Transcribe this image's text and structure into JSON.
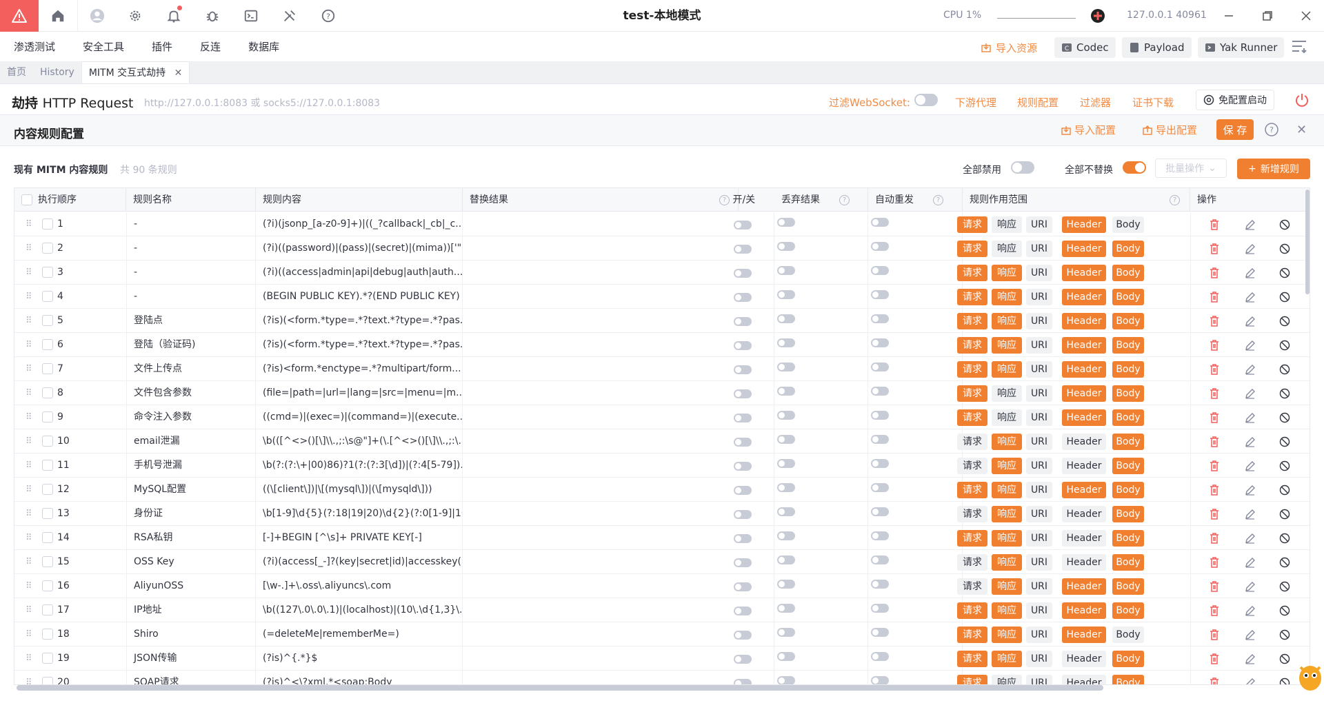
{
  "window": {
    "title": "test-本地模式",
    "cpu": "CPU 1%",
    "address": "127.0.0.1 40961"
  },
  "menu": [
    "渗透测试",
    "安全工具",
    "插件",
    "反连",
    "数据库"
  ],
  "toolbar": {
    "import_resource": "导入资源",
    "codec": "Codec",
    "payload": "Payload",
    "yak_runner": "Yak Runner"
  },
  "tabs": [
    {
      "label": "首页"
    },
    {
      "label": "History"
    },
    {
      "label": "MITM 交互式劫持",
      "closable": true
    }
  ],
  "hijack": {
    "title_cn": "劫持",
    "title_en": "HTTP Request",
    "listen": "http://127.0.0.1:8083 或 socks5://127.0.0.1:8083",
    "filter_ws": "过滤WebSocket:",
    "downstream_proxy": "下游代理",
    "rule_config": "规则配置",
    "filter": "过滤器",
    "cert_download": "证书下载",
    "no_config_start": "免配置启动"
  },
  "panel": {
    "title": "内容规则配置",
    "import_config": "导入配置",
    "export_config": "导出配置",
    "save": "保 存"
  },
  "rules_header": {
    "title": "现有 MITM 内容规则",
    "count": "共 90 条规则",
    "disable_all": "全部禁用",
    "no_replace_all": "全部不替换",
    "batch_ops": "批量操作",
    "new_rule": "新增规则"
  },
  "columns": {
    "order": "执行顺序",
    "name": "规则名称",
    "content": "规则内容",
    "replace": "替换结果",
    "onoff": "开/关",
    "discard": "丢弃结果",
    "auto_replay": "自动重发",
    "scope": "规则作用范围",
    "ops": "操作"
  },
  "scope_labels": [
    "请求",
    "响应",
    "URI",
    "Header",
    "Body"
  ],
  "rules": [
    {
      "order": "1",
      "name": "-",
      "content": "(?i)(jsonp_[a-z0-9]+)|((_?callback|_cb|_c...",
      "scope": [
        true,
        false,
        false,
        true,
        false
      ]
    },
    {
      "order": "2",
      "name": "-",
      "content": "(?i)((password)|(pass)|(secret)|(mima))['\"...",
      "scope": [
        true,
        false,
        false,
        true,
        true
      ]
    },
    {
      "order": "3",
      "name": "-",
      "content": "(?i)((access|admin|api|debug|auth|auth...",
      "scope": [
        true,
        true,
        false,
        true,
        true
      ]
    },
    {
      "order": "4",
      "name": "-",
      "content": "(BEGIN PUBLIC KEY).*?(END PUBLIC KEY)",
      "scope": [
        true,
        true,
        false,
        true,
        true
      ]
    },
    {
      "order": "5",
      "name": "登陆点",
      "content": "(?is)(<form.*type=.*?text.*?type=.*?pas...",
      "scope": [
        true,
        true,
        false,
        true,
        true
      ]
    },
    {
      "order": "6",
      "name": "登陆（验证码)",
      "content": "(?is)(<form.*type=.*?text.*?type=.*?pas...",
      "scope": [
        true,
        true,
        false,
        true,
        true
      ]
    },
    {
      "order": "7",
      "name": "文件上传点",
      "content": "(?is)<form.*enctype=.*?multipart/form...",
      "scope": [
        true,
        true,
        false,
        true,
        true
      ]
    },
    {
      "order": "8",
      "name": "文件包含参数",
      "content": "(file=|path=|url=|lang=|src=|menu=|m...",
      "scope": [
        true,
        false,
        false,
        true,
        true
      ]
    },
    {
      "order": "9",
      "name": "命令注入参数",
      "content": "((cmd=)|(exec=)|(command=)|(execute...",
      "scope": [
        true,
        false,
        false,
        true,
        true
      ]
    },
    {
      "order": "10",
      "name": "email泄漏",
      "content": "\\b(([^<>()[\\]\\\\.,;:\\s@\"]+(\\.[^<>()[\\]\\\\.,;:\\...",
      "scope": [
        false,
        true,
        false,
        false,
        true
      ]
    },
    {
      "order": "11",
      "name": "手机号泄漏",
      "content": "\\b(?:(?:\\+|00)86)?1(?:(?:3[\\d])|(?:4[5-79])...",
      "scope": [
        false,
        true,
        false,
        false,
        true
      ]
    },
    {
      "order": "12",
      "name": "MySQL配置",
      "content": "((\\[client\\])|\\[(mysql\\])|(\\[mysqld\\]))",
      "scope": [
        true,
        true,
        false,
        true,
        true
      ]
    },
    {
      "order": "13",
      "name": "身份证",
      "content": "\\b[1-9]\\d{5}(?:18|19|20)\\d{2}(?:0[1-9]|10...",
      "scope": [
        false,
        true,
        false,
        false,
        true
      ]
    },
    {
      "order": "14",
      "name": "RSA私钥",
      "content": "[-]+BEGIN [^\\s]+ PRIVATE KEY[-]",
      "scope": [
        true,
        true,
        false,
        false,
        true
      ]
    },
    {
      "order": "15",
      "name": "OSS Key",
      "content": "(?i)(access[_-]?(key|secret|id)|accesskey(...",
      "scope": [
        false,
        true,
        false,
        false,
        true
      ]
    },
    {
      "order": "16",
      "name": "AliyunOSS",
      "content": "[\\w-.]+\\.oss\\.aliyuncs\\.com",
      "scope": [
        false,
        true,
        false,
        true,
        true
      ]
    },
    {
      "order": "17",
      "name": "IP地址",
      "content": "\\b((127\\.0\\.0\\.1)|(localhost)|(10\\.\\d{1,3}\\...",
      "scope": [
        true,
        true,
        false,
        true,
        true
      ]
    },
    {
      "order": "18",
      "name": "Shiro",
      "content": "(=deleteMe|rememberMe=)",
      "scope": [
        true,
        true,
        false,
        true,
        false
      ]
    },
    {
      "order": "19",
      "name": "JSON传输",
      "content": "(?is)^{.*}$",
      "scope": [
        true,
        true,
        false,
        false,
        true
      ]
    },
    {
      "order": "20",
      "name": "SOAP请求",
      "content": "(?is)^<\\?xml.*<soap:Body",
      "scope": [
        true,
        false,
        false,
        false,
        true
      ]
    }
  ],
  "colors": {
    "accent": "#f17f30",
    "brand": "#f25f5c"
  }
}
